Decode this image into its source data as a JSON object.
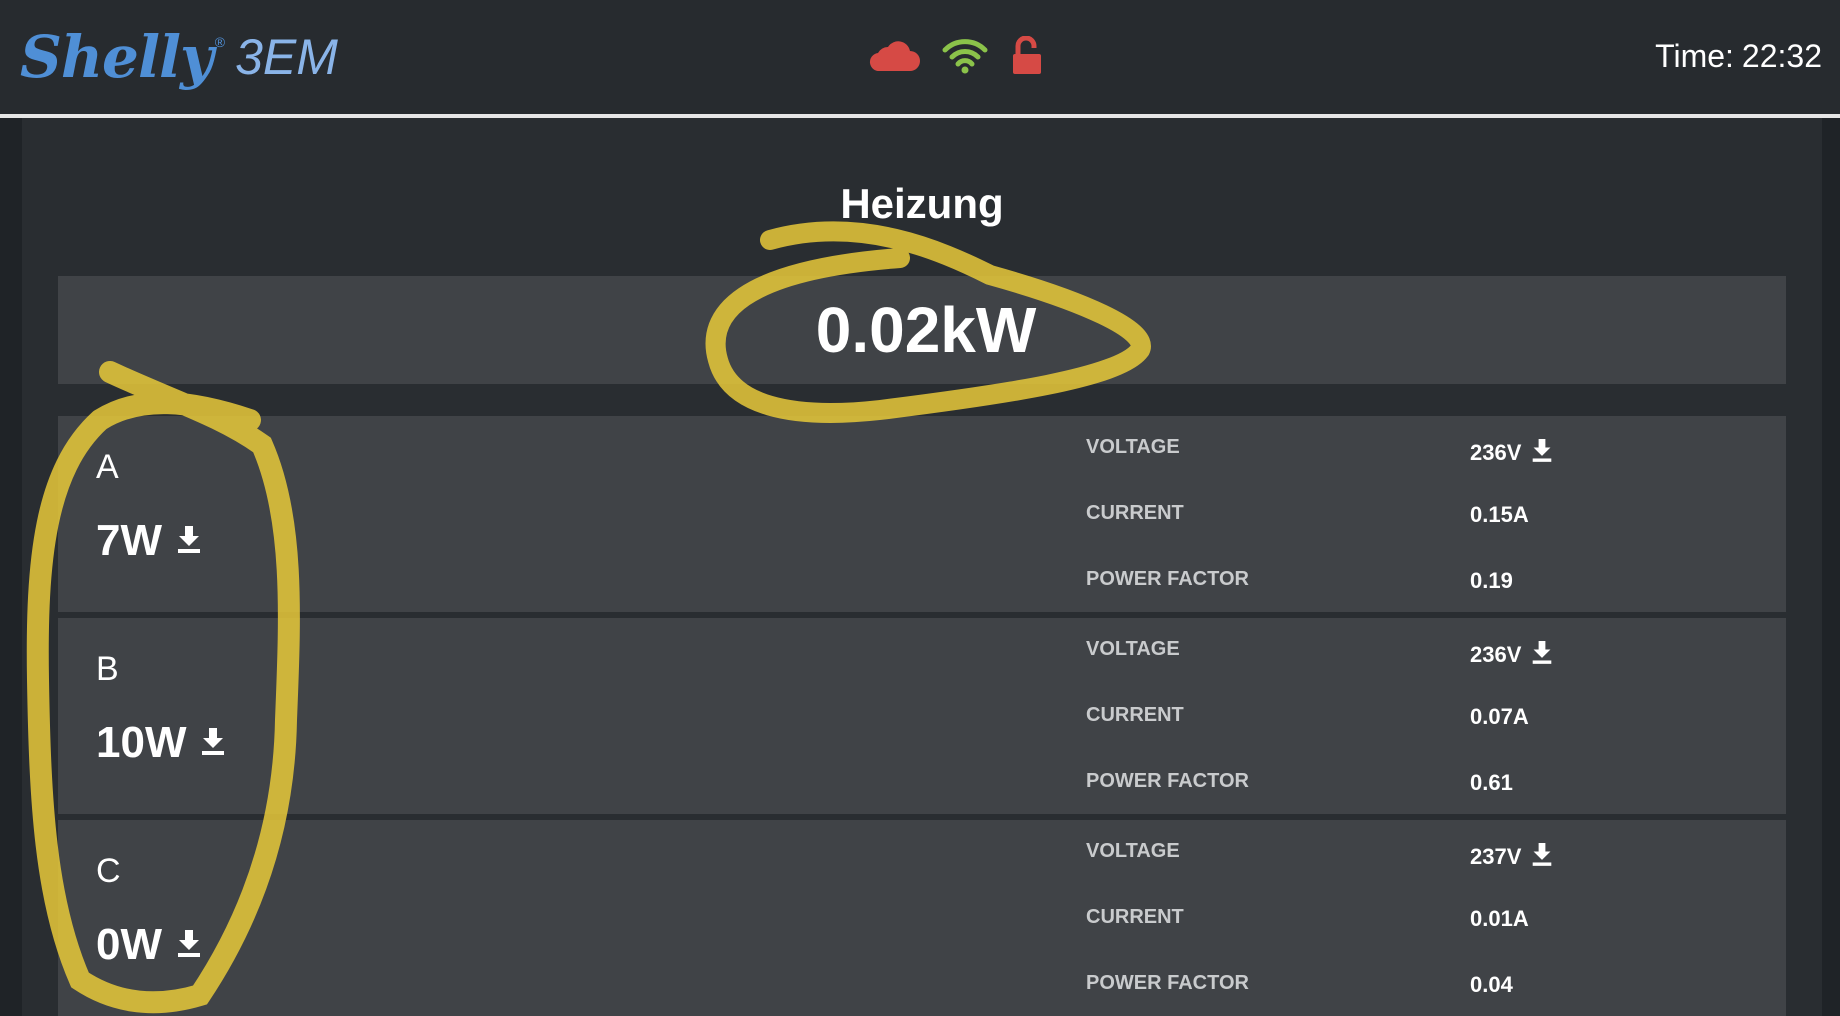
{
  "header": {
    "brand": "Shelly",
    "registered_mark": "®",
    "model": "3EM",
    "status_icons": [
      "cloud-icon",
      "wifi-icon",
      "unlock-icon"
    ],
    "time_label": "Time:",
    "time_value": "22:32"
  },
  "device": {
    "name": "Heizung",
    "total_power": "0.02kW"
  },
  "phases": [
    {
      "name": "A",
      "power": "7W",
      "metrics": {
        "voltage_label": "VOLTAGE",
        "voltage": "236V",
        "current_label": "CURRENT",
        "current": "0.15A",
        "pf_label": "POWER FACTOR",
        "pf": "0.19"
      }
    },
    {
      "name": "B",
      "power": "10W",
      "metrics": {
        "voltage_label": "VOLTAGE",
        "voltage": "236V",
        "current_label": "CURRENT",
        "current": "0.07A",
        "pf_label": "POWER FACTOR",
        "pf": "0.61"
      }
    },
    {
      "name": "C",
      "power": "0W",
      "metrics": {
        "voltage_label": "VOLTAGE",
        "voltage": "237V",
        "current_label": "CURRENT",
        "current": "0.01A",
        "pf_label": "POWER FACTOR",
        "pf": "0.04"
      }
    }
  ],
  "colors": {
    "cloud": "#d64a45",
    "wifi": "#8bc34a",
    "lock": "#d64a45",
    "highlight": "#e8c93a"
  }
}
